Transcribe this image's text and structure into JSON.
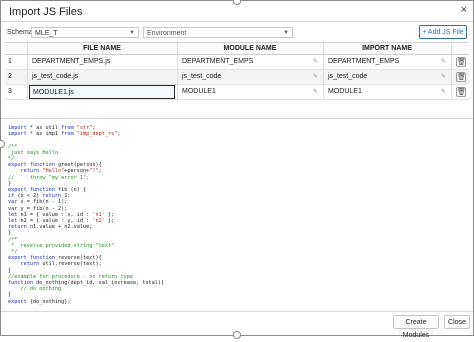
{
  "dialog": {
    "title": "Import JS Files",
    "close_icon": "×"
  },
  "controls": {
    "schema_label": "Schema",
    "schema_value": "MLE_T",
    "environment_placeholder": "Environment",
    "add_button": "+ Add JS File"
  },
  "table": {
    "headers": [
      "FILE NAME",
      "MODULE NAME",
      "IMPORT NAME"
    ],
    "rows": [
      {
        "num": "1",
        "file": "DEPARTMENT_EMPS.js",
        "module": "DEPARTMENT_EMPS",
        "import": "DEPARTMENT_EMPS"
      },
      {
        "num": "2",
        "file": "js_test_code.js",
        "module": "js_test_code",
        "import": "js_test_code"
      },
      {
        "num": "3",
        "file": "MODULE1.js",
        "module": "MODULE1",
        "import": "MODULE1"
      }
    ]
  },
  "code_lines": [
    [
      [
        "kw",
        "import"
      ],
      [
        "t",
        " * as util "
      ],
      [
        "kw",
        "from"
      ],
      [
        "t",
        " "
      ],
      [
        "str",
        "\"str\""
      ],
      [
        "t",
        ";"
      ]
    ],
    [
      [
        "kw",
        "import"
      ],
      [
        "t",
        " * as imp1 "
      ],
      [
        "kw",
        "from"
      ],
      [
        "t",
        " "
      ],
      [
        "str",
        "\"imp_dept_rs\""
      ],
      [
        "t",
        ";"
      ]
    ],
    [
      [
        "t",
        ""
      ]
    ],
    [
      [
        "cm",
        "/**"
      ]
    ],
    [
      [
        "cm",
        " just says Hello"
      ]
    ],
    [
      [
        "cm",
        "*/"
      ]
    ],
    [
      [
        "kw",
        "export function"
      ],
      [
        "t",
        " greet(person){"
      ]
    ],
    [
      [
        "t",
        "    "
      ],
      [
        "kw",
        "return"
      ],
      [
        "t",
        " "
      ],
      [
        "str",
        "\"Hello\""
      ],
      [
        "t",
        "+person+"
      ],
      [
        "str",
        "\"!\""
      ],
      [
        "t",
        ";"
      ]
    ],
    [
      [
        "cm",
        "//     throw \"my error 1\";"
      ]
    ],
    [
      [
        "t",
        "}"
      ]
    ],
    [
      [
        "kw",
        "export function"
      ],
      [
        "t",
        " fib (n) {"
      ]
    ],
    [
      [
        "kw",
        "if"
      ],
      [
        "t",
        " (n < 2) "
      ],
      [
        "kw",
        "return"
      ],
      [
        "t",
        " 1;"
      ]
    ],
    [
      [
        "kw",
        "var"
      ],
      [
        "t",
        " x = fib(n - 1);"
      ]
    ],
    [
      [
        "kw",
        "var"
      ],
      [
        "t",
        " y = fib(n - 2);"
      ]
    ],
    [
      [
        "kw",
        "let"
      ],
      [
        "t",
        " n1 = { value : x, id : "
      ],
      [
        "str",
        "'n1'"
      ],
      [
        "t",
        " };"
      ]
    ],
    [
      [
        "kw",
        "let"
      ],
      [
        "t",
        " n2 = { value : y, id : "
      ],
      [
        "str",
        "'n2'"
      ],
      [
        "t",
        " };"
      ]
    ],
    [
      [
        "kw",
        "return"
      ],
      [
        "t",
        " n1.value + n2.value;"
      ]
    ],
    [
      [
        "t",
        "}"
      ]
    ],
    [
      [
        "cm",
        "/**"
      ]
    ],
    [
      [
        "cm",
        " *  reverse provided string \"text\""
      ]
    ],
    [
      [
        "cm",
        " */"
      ]
    ],
    [
      [
        "kw",
        "export function"
      ],
      [
        "t",
        " reverse(text){"
      ]
    ],
    [
      [
        "t",
        "    "
      ],
      [
        "kw",
        "return"
      ],
      [
        "t",
        " util.reverse(text);"
      ]
    ],
    [
      [
        "t",
        "}"
      ]
    ],
    [
      [
        "cm",
        "//example for procedure - no return type"
      ]
    ],
    [
      [
        "kw",
        "function"
      ],
      [
        "t",
        " do_nothing(dept_id, sal_increase, total){"
      ]
    ],
    [
      [
        "cm",
        "    // do nothing"
      ]
    ],
    [
      [
        "t",
        "}"
      ]
    ],
    [
      [
        "kw",
        "export"
      ],
      [
        "t",
        " {do_nothing};"
      ]
    ]
  ],
  "footer": {
    "create_button": "Create Modules",
    "close_button": "Close"
  }
}
